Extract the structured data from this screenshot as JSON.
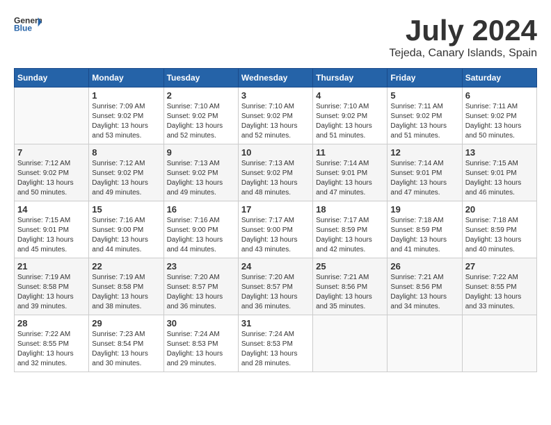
{
  "logo": {
    "text_general": "General",
    "text_blue": "Blue"
  },
  "title": "July 2024",
  "subtitle": "Tejeda, Canary Islands, Spain",
  "days_of_week": [
    "Sunday",
    "Monday",
    "Tuesday",
    "Wednesday",
    "Thursday",
    "Friday",
    "Saturday"
  ],
  "weeks": [
    [
      {
        "day": "",
        "info": ""
      },
      {
        "day": "1",
        "info": "Sunrise: 7:09 AM\nSunset: 9:02 PM\nDaylight: 13 hours\nand 53 minutes."
      },
      {
        "day": "2",
        "info": "Sunrise: 7:10 AM\nSunset: 9:02 PM\nDaylight: 13 hours\nand 52 minutes."
      },
      {
        "day": "3",
        "info": "Sunrise: 7:10 AM\nSunset: 9:02 PM\nDaylight: 13 hours\nand 52 minutes."
      },
      {
        "day": "4",
        "info": "Sunrise: 7:10 AM\nSunset: 9:02 PM\nDaylight: 13 hours\nand 51 minutes."
      },
      {
        "day": "5",
        "info": "Sunrise: 7:11 AM\nSunset: 9:02 PM\nDaylight: 13 hours\nand 51 minutes."
      },
      {
        "day": "6",
        "info": "Sunrise: 7:11 AM\nSunset: 9:02 PM\nDaylight: 13 hours\nand 50 minutes."
      }
    ],
    [
      {
        "day": "7",
        "info": "Sunrise: 7:12 AM\nSunset: 9:02 PM\nDaylight: 13 hours\nand 50 minutes."
      },
      {
        "day": "8",
        "info": "Sunrise: 7:12 AM\nSunset: 9:02 PM\nDaylight: 13 hours\nand 49 minutes."
      },
      {
        "day": "9",
        "info": "Sunrise: 7:13 AM\nSunset: 9:02 PM\nDaylight: 13 hours\nand 49 minutes."
      },
      {
        "day": "10",
        "info": "Sunrise: 7:13 AM\nSunset: 9:02 PM\nDaylight: 13 hours\nand 48 minutes."
      },
      {
        "day": "11",
        "info": "Sunrise: 7:14 AM\nSunset: 9:01 PM\nDaylight: 13 hours\nand 47 minutes."
      },
      {
        "day": "12",
        "info": "Sunrise: 7:14 AM\nSunset: 9:01 PM\nDaylight: 13 hours\nand 47 minutes."
      },
      {
        "day": "13",
        "info": "Sunrise: 7:15 AM\nSunset: 9:01 PM\nDaylight: 13 hours\nand 46 minutes."
      }
    ],
    [
      {
        "day": "14",
        "info": "Sunrise: 7:15 AM\nSunset: 9:01 PM\nDaylight: 13 hours\nand 45 minutes."
      },
      {
        "day": "15",
        "info": "Sunrise: 7:16 AM\nSunset: 9:00 PM\nDaylight: 13 hours\nand 44 minutes."
      },
      {
        "day": "16",
        "info": "Sunrise: 7:16 AM\nSunset: 9:00 PM\nDaylight: 13 hours\nand 44 minutes."
      },
      {
        "day": "17",
        "info": "Sunrise: 7:17 AM\nSunset: 9:00 PM\nDaylight: 13 hours\nand 43 minutes."
      },
      {
        "day": "18",
        "info": "Sunrise: 7:17 AM\nSunset: 8:59 PM\nDaylight: 13 hours\nand 42 minutes."
      },
      {
        "day": "19",
        "info": "Sunrise: 7:18 AM\nSunset: 8:59 PM\nDaylight: 13 hours\nand 41 minutes."
      },
      {
        "day": "20",
        "info": "Sunrise: 7:18 AM\nSunset: 8:59 PM\nDaylight: 13 hours\nand 40 minutes."
      }
    ],
    [
      {
        "day": "21",
        "info": "Sunrise: 7:19 AM\nSunset: 8:58 PM\nDaylight: 13 hours\nand 39 minutes."
      },
      {
        "day": "22",
        "info": "Sunrise: 7:19 AM\nSunset: 8:58 PM\nDaylight: 13 hours\nand 38 minutes."
      },
      {
        "day": "23",
        "info": "Sunrise: 7:20 AM\nSunset: 8:57 PM\nDaylight: 13 hours\nand 36 minutes."
      },
      {
        "day": "24",
        "info": "Sunrise: 7:20 AM\nSunset: 8:57 PM\nDaylight: 13 hours\nand 36 minutes."
      },
      {
        "day": "25",
        "info": "Sunrise: 7:21 AM\nSunset: 8:56 PM\nDaylight: 13 hours\nand 35 minutes."
      },
      {
        "day": "26",
        "info": "Sunrise: 7:21 AM\nSunset: 8:56 PM\nDaylight: 13 hours\nand 34 minutes."
      },
      {
        "day": "27",
        "info": "Sunrise: 7:22 AM\nSunset: 8:55 PM\nDaylight: 13 hours\nand 33 minutes."
      }
    ],
    [
      {
        "day": "28",
        "info": "Sunrise: 7:22 AM\nSunset: 8:55 PM\nDaylight: 13 hours\nand 32 minutes."
      },
      {
        "day": "29",
        "info": "Sunrise: 7:23 AM\nSunset: 8:54 PM\nDaylight: 13 hours\nand 30 minutes."
      },
      {
        "day": "30",
        "info": "Sunrise: 7:24 AM\nSunset: 8:53 PM\nDaylight: 13 hours\nand 29 minutes."
      },
      {
        "day": "31",
        "info": "Sunrise: 7:24 AM\nSunset: 8:53 PM\nDaylight: 13 hours\nand 28 minutes."
      },
      {
        "day": "",
        "info": ""
      },
      {
        "day": "",
        "info": ""
      },
      {
        "day": "",
        "info": ""
      }
    ]
  ]
}
